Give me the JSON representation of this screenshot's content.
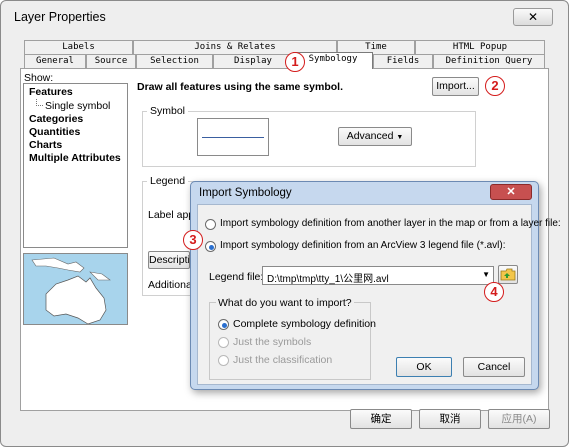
{
  "window": {
    "title": "Layer Properties",
    "close_glyph": "✕"
  },
  "tabs_back": [
    "Labels",
    "Joins & Relates",
    "Time",
    "HTML Popup"
  ],
  "tabs_front": [
    "General",
    "Source",
    "Selection",
    "Display",
    "Symbology",
    "Fields",
    "Definition Query"
  ],
  "show": {
    "label": "Show:",
    "items": [
      {
        "label": "Features",
        "sub": false
      },
      {
        "label": "Single symbol",
        "sub": true
      },
      {
        "label": "Categories",
        "sub": false
      },
      {
        "label": "Quantities",
        "sub": false
      },
      {
        "label": "Charts",
        "sub": false
      },
      {
        "label": "Multiple Attributes",
        "sub": false
      }
    ]
  },
  "symbology": {
    "heading": "Draw all features using the same symbol.",
    "import_button": "Import...",
    "symbol_group": "Symbol",
    "advanced_button": "Advanced",
    "legend_group": "Legend",
    "label_appears": "Label appe",
    "description_button": "Descripti",
    "additional": "Additional"
  },
  "callouts": [
    "1",
    "2",
    "3",
    "4"
  ],
  "import_dialog": {
    "title": "Import Symbology",
    "close_glyph": "✕",
    "option_layer": "Import symbology definition from another layer in the map or from a layer file:",
    "option_avl": "Import symbology definition from an ArcView 3 legend file (*.avl):",
    "legend_file_label": "Legend file:",
    "legend_file_value": "D:\\tmp\\tmp\\tty_1\\公里网.avl",
    "question": "What do you want to import?",
    "import_options": [
      "Complete symbology definition",
      "Just the symbols",
      "Just the classification"
    ],
    "ok": "OK",
    "cancel": "Cancel"
  },
  "footer": {
    "ok": "确定",
    "cancel": "取消",
    "apply": "应用(A)"
  }
}
